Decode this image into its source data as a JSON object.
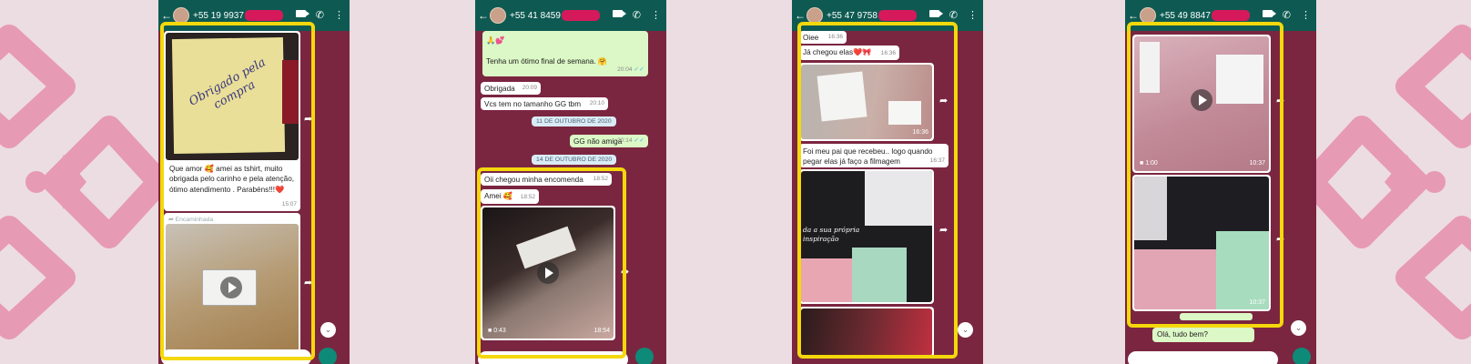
{
  "colors": {
    "background": "#ecdde2",
    "chat_bg": "#7a2640",
    "header": "#0e5a52",
    "highlight": "#f4d80b",
    "redaction": "#d6195b",
    "decor": "#e79ab4"
  },
  "phone1": {
    "contact_number": "+55 19 9937",
    "sticky_note_text": "Obrigado pela compra",
    "message": "Que amor 🥰 amei as tshirt, muito obrigada pelo carinho e pela atenção, ótimo atendimento . Parabéns!!!❤️",
    "message_time": "15:07",
    "forwarded_label": "Encaminhada"
  },
  "phone2": {
    "contact_number": "+55 41 8459",
    "msg_top_emoji": "🙏💕",
    "msg_top": "Tenha um ótimo final de semana. 🤗",
    "msg_top_time": "20:04",
    "msg_obrigada": "Obrigada",
    "msg_obrigada_time": "20:09",
    "msg_gg": "Vcs tem no tamanho GG tbm",
    "msg_gg_time": "20:10",
    "date1": "11 DE OUTUBRO DE 2020",
    "msg_gg_nao": "GG não amiga",
    "msg_gg_nao_time": "20:14",
    "date2": "14 DE OUTUBRO DE 2020",
    "msg_chegou": "Oii chegou minha encomenda",
    "msg_chegou_time": "18:52",
    "msg_amei": "Amei 🥰",
    "msg_amei_time": "18:52",
    "video_duration": "0:43",
    "video_time": "18:54"
  },
  "phone3": {
    "contact_number": "+55 47 9758",
    "msg_oiee": "Oiee",
    "msg_oiee_time": "16:36",
    "msg_chegou": "Já chegou elas❤️🎀",
    "msg_chegou_time": "16:36",
    "photo1_time": "16:36",
    "msg_pai": "Foi meu pai que recebeu.. logo quando pegar elas já faço a filmagem",
    "msg_pai_time": "16:37",
    "shirt_print": "da a sua própria inspiração"
  },
  "phone4": {
    "contact_number": "+55 49 8847",
    "video_duration": "1:00",
    "video_time": "10:37",
    "photo_time": "10:37",
    "msg_ola": "Olá, tudo bem?"
  }
}
